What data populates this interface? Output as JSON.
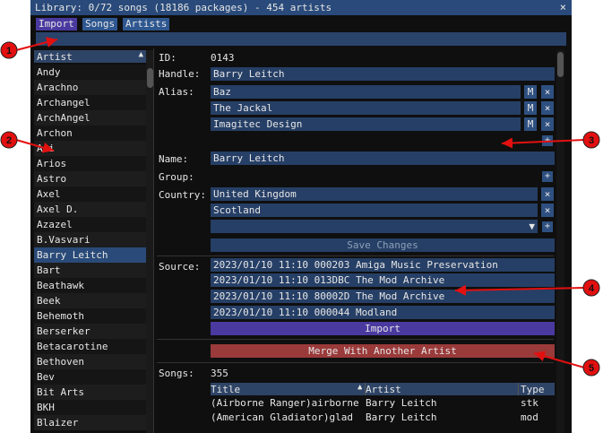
{
  "window": {
    "title": "Library: 0/72 songs (18186 packages) - 454 artists",
    "close_glyph": "×",
    "tabs": [
      {
        "label": "Import",
        "active": true
      },
      {
        "label": "Songs",
        "active": false
      },
      {
        "label": "Artists",
        "active": false
      }
    ],
    "filter_value": ""
  },
  "artist_list": {
    "header": "Artist",
    "sort_glyph": "▲",
    "items": [
      "Andy",
      "Arachno",
      "Archangel",
      "ArchAngel",
      "Archon",
      "Ari",
      "Arios",
      "Astro",
      "Axel",
      "Axel D.",
      "Azazel",
      "B.Vasvari",
      "Barry Leitch",
      "Bart",
      "Beathawk",
      "Beek",
      "Behemoth",
      "Berserker",
      "Betacarotine",
      "Bethoven",
      "Bev",
      "Bit Arts",
      "BKH",
      "Blaizer"
    ],
    "selected_index": 12
  },
  "detail": {
    "id_label": "ID:",
    "id_value": "0143",
    "handle_label": "Handle:",
    "handle_value": "Barry Leitch",
    "alias_label": "Alias:",
    "aliases": [
      "Baz",
      "The Jackal",
      "Imagitec Design"
    ],
    "alias_m_glyph": "M",
    "remove_glyph": "×",
    "add_glyph": "+",
    "name_label": "Name:",
    "name_value": "Barry Leitch",
    "group_label": "Group:",
    "country_label": "Country:",
    "countries": [
      "United Kingdom",
      "Scotland"
    ],
    "dropdown_glyph": "▼",
    "save_label": "Save Changes",
    "source_label": "Source:",
    "sources": [
      "2023/01/10 11:10 000203 Amiga Music Preservation",
      "2023/01/10 11:10 013DBC The Mod Archive",
      "2023/01/10 11:10 80002D The Mod Archive",
      "2023/01/10 11:10 000044 Modland"
    ],
    "import_label": "Import",
    "merge_label": "Merge With Another Artist",
    "songs_label": "Songs:",
    "songs_count": "355",
    "songs_table": {
      "headers": [
        "Title",
        "Artist",
        "Type"
      ],
      "sort_glyph": "▲",
      "rows": [
        [
          "(Airborne Ranger)airborne",
          "Barry Leitch",
          "stk"
        ],
        [
          "(American Gladiator)glad",
          "Barry Leitch",
          "mod"
        ]
      ]
    }
  },
  "annotations": [
    "1",
    "2",
    "3",
    "4",
    "5"
  ],
  "colors": {
    "title_bar": "#294a7a",
    "field_bg": "#263f66",
    "import_button": "#4a3aa0",
    "merge_button": "#9a3a3a",
    "annotation_red": "#e31010"
  }
}
